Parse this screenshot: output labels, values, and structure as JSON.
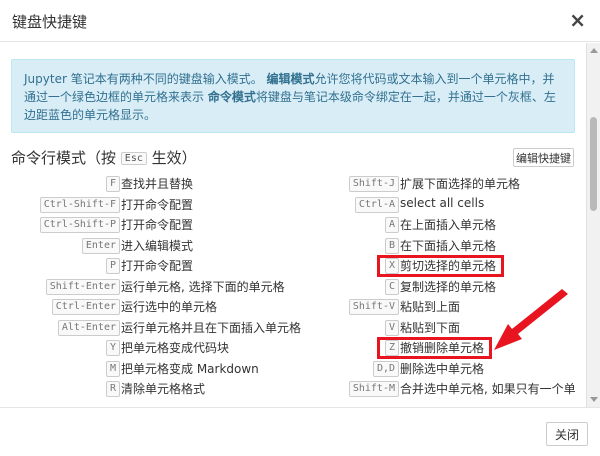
{
  "dialog": {
    "title": "键盘快捷键",
    "close_symbol": "×",
    "close_button_label": "关闭"
  },
  "info": {
    "text_1": "Jupyter 笔记本有两种不同的键盘输入模式。",
    "bold_1": "编辑模式",
    "text_2": "允许您将代码或文本输入到一个单元格中，并通过一个绿色边框的单元格来表示",
    "bold_2": "命令模式",
    "text_3": "将键盘与笔记本级命令绑定在一起，并通过一个灰框、左边距蓝色的单元格显示。"
  },
  "section": {
    "title_prefix": "命令行模式（按",
    "title_key": "Esc",
    "title_suffix": "生效）",
    "edit_shortcuts_label": "编辑快捷键"
  },
  "shortcuts_left": [
    {
      "key": "F",
      "desc": "查找并且替换"
    },
    {
      "key": "Ctrl-Shift-F",
      "desc": "打开命令配置"
    },
    {
      "key": "Ctrl-Shift-P",
      "desc": "打开命令配置"
    },
    {
      "key": "Enter",
      "desc": "进入编辑模式"
    },
    {
      "key": "P",
      "desc": "打开命令配置"
    },
    {
      "key": "Shift-Enter",
      "desc": "运行单元格, 选择下面的单元格"
    },
    {
      "key": "Ctrl-Enter",
      "desc": "运行选中的单元格"
    },
    {
      "key": "Alt-Enter",
      "desc": "运行单元格并且在下面插入单元格"
    },
    {
      "key": "Y",
      "desc": "把单元格变成代码块"
    },
    {
      "key": "M",
      "desc": "把单元格变成 Markdown"
    },
    {
      "key": "R",
      "desc": "清除单元格格式"
    }
  ],
  "shortcuts_right": [
    {
      "key": "Shift-J",
      "desc": "扩展下面选择的单元格"
    },
    {
      "key": "Ctrl-A",
      "desc": "select all cells"
    },
    {
      "key": "A",
      "desc": "在上面插入单元格"
    },
    {
      "key": "B",
      "desc": "在下面插入单元格"
    },
    {
      "key": "X",
      "desc": "剪切选择的单元格"
    },
    {
      "key": "C",
      "desc": "复制选择的单元格"
    },
    {
      "key": "Shift-V",
      "desc": "粘贴到上面"
    },
    {
      "key": "V",
      "desc": "粘贴到下面"
    },
    {
      "key": "Z",
      "desc": "撤销删除单元格"
    },
    {
      "key": "D,D",
      "desc": "删除选中单元格"
    },
    {
      "key": "Shift-M",
      "desc": "合并选中单元格, 如果只有一个单"
    }
  ],
  "annotation_color": "#e8141f"
}
